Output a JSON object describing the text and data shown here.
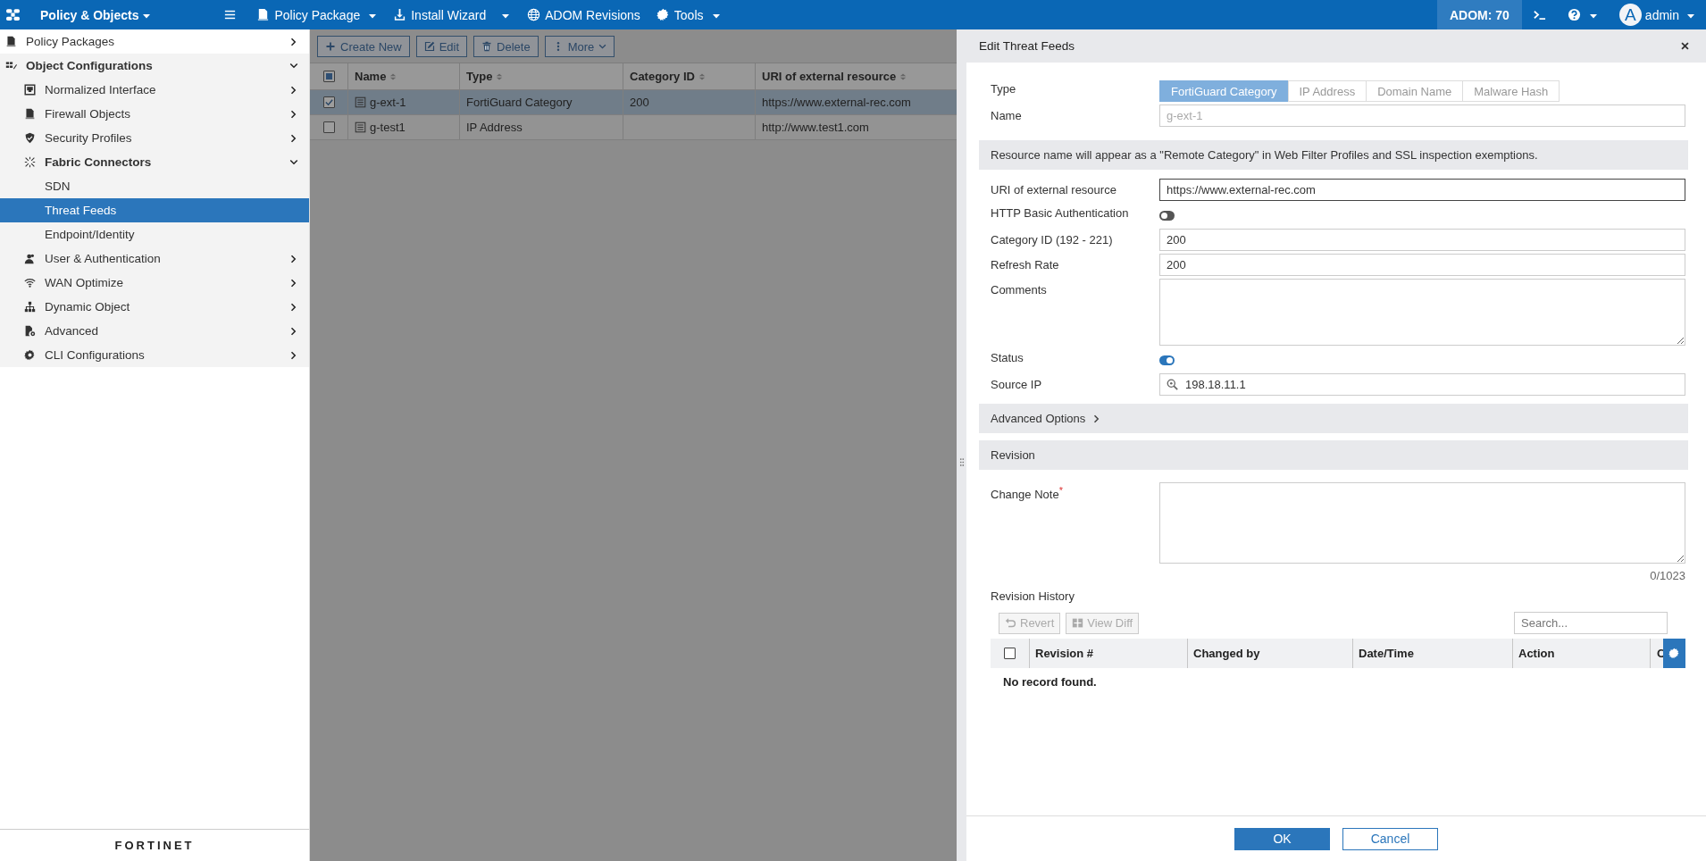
{
  "top_bar": {
    "app_menu": "Policy & Objects",
    "menu_items": [
      {
        "label": "Policy Package",
        "dropdown": true
      },
      {
        "label": "Install Wizard",
        "split_dropdown": true
      },
      {
        "label": "ADOM Revisions"
      },
      {
        "label": "Tools",
        "dropdown": true
      }
    ],
    "adom": "ADOM: 70",
    "avatar": "A",
    "user": "admin"
  },
  "sidebar": {
    "items": [
      {
        "label": "Policy Packages",
        "expanded": false,
        "selected": false
      },
      {
        "label": "Object Configurations",
        "expanded": true,
        "selected": false,
        "children": [
          {
            "label": "Normalized Interface",
            "expanded": false,
            "selected": false
          },
          {
            "label": "Firewall Objects",
            "expanded": false,
            "selected": false
          },
          {
            "label": "Security Profiles",
            "expanded": false,
            "selected": false
          },
          {
            "label": "Fabric Connectors",
            "expanded": true,
            "selected": false,
            "children": [
              {
                "label": "SDN",
                "selected": false
              },
              {
                "label": "Threat Feeds",
                "selected": true
              },
              {
                "label": "Endpoint/Identity",
                "selected": false
              }
            ]
          },
          {
            "label": "User & Authentication",
            "expanded": false,
            "selected": false
          },
          {
            "label": "WAN Optimize",
            "expanded": false,
            "selected": false
          },
          {
            "label": "Dynamic Object",
            "expanded": false,
            "selected": false
          },
          {
            "label": "Advanced",
            "expanded": false,
            "selected": false
          },
          {
            "label": "CLI Configurations",
            "expanded": false,
            "selected": false
          }
        ]
      }
    ],
    "logo": "FORTINET"
  },
  "toolbar": [
    {
      "label": "Create New"
    },
    {
      "label": "Edit"
    },
    {
      "label": "Delete"
    },
    {
      "label": "More",
      "caret": true
    }
  ],
  "table": {
    "header_checkbox": {
      "indeterminate": true
    },
    "columns": [
      "Name",
      "Type",
      "Category ID",
      "URI of external resource"
    ],
    "rows": [
      {
        "checked": true,
        "selected": true,
        "cells": [
          "g-ext-1",
          "FortiGuard Category",
          "200",
          "https://www.external-rec.com"
        ]
      },
      {
        "checked": false,
        "selected": false,
        "cells": [
          "g-test1",
          "IP Address",
          "",
          "http://www.test1.com"
        ]
      }
    ]
  },
  "panel": {
    "title": "Edit Threat Feeds",
    "type": {
      "label": "Type",
      "options": [
        {
          "label": "FortiGuard Category",
          "selected": true
        },
        {
          "label": "IP Address",
          "selected": false
        },
        {
          "label": "Domain Name",
          "selected": false
        },
        {
          "label": "Malware Hash",
          "selected": false
        }
      ]
    },
    "name": {
      "label": "Name",
      "value": "g-ext-1",
      "disabled": true
    },
    "notice": "Resource name will appear as a \"Remote Category\" in Web Filter Profiles and SSL inspection exemptions.",
    "fields": [
      {
        "kind": "text",
        "label": "URI of external resource",
        "value": "https://www.external-rec.com",
        "focused": true
      },
      {
        "kind": "toggle",
        "label": "HTTP Basic Authentication",
        "on": false
      },
      {
        "kind": "text",
        "label": "Category ID (192 - 221)",
        "value": "200",
        "focused": false
      },
      {
        "kind": "text",
        "label": "Refresh Rate",
        "value": "200",
        "focused": false
      },
      {
        "kind": "textarea",
        "label": "Comments"
      },
      {
        "kind": "toggle",
        "label": "Status",
        "on": true
      },
      {
        "kind": "search",
        "label": "Source IP",
        "value": "198.18.11.1"
      }
    ],
    "advanced": {
      "label": "Advanced Options",
      "expanded": false
    },
    "revision": {
      "title": "Revision",
      "note_label": "Change Note$^{*}$",
      "counter": "0/1023",
      "history_label": "Revision History",
      "buttons": [
        {
          "label": "Revert",
          "disabled": true
        },
        {
          "label": "View Diff",
          "disabled": true
        }
      ],
      "search_placeholder": "Search...",
      "all_checked": false,
      "columns": [
        "Revision #",
        "Changed by",
        "Date/Time",
        "Action",
        "C"
      ],
      "empty": "No record found."
    },
    "footer": [
      {
        "label": "OK",
        "kind": "primary"
      },
      {
        "label": "Cancel",
        "kind": "secondary"
      }
    ]
  }
}
